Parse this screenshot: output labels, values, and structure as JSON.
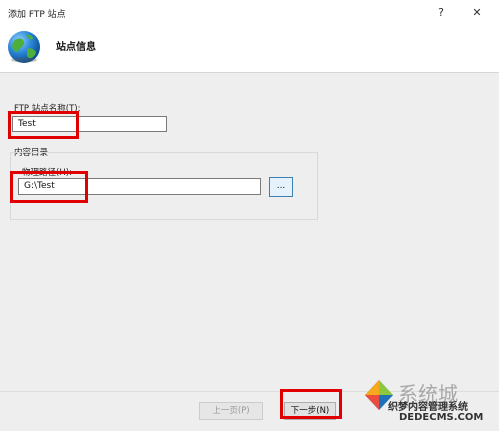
{
  "window": {
    "title": "添加 FTP 站点",
    "help_label": "?",
    "close_label": "✕"
  },
  "header": {
    "title": "站点信息"
  },
  "form": {
    "site_name_label": "FTP 站点名称(T):",
    "site_name_value": "Test",
    "content_dir_label": "内容目录",
    "physical_path_label": "物理路径(H):",
    "physical_path_value": "G:\\Test",
    "browse_label": "..."
  },
  "footer": {
    "prev_label": "上一页(P)",
    "next_label": "下一步(N)"
  },
  "watermark": {
    "big_text": "系统城",
    "url_text": "xitongcheng.com",
    "cn_text": "织梦内容管理系统",
    "domain_text": "DEDECMS.COM"
  },
  "colors": {
    "highlight_red": "#e00000",
    "focus_blue": "#3c7fb1"
  }
}
